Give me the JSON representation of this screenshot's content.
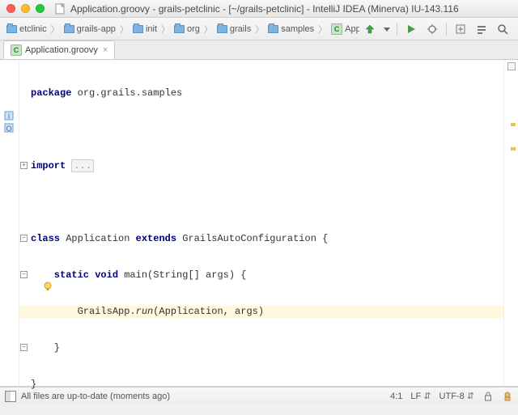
{
  "title": "Application.groovy - grails-petclinic - [~/grails-petclinic] - IntelliJ IDEA (Minerva) IU-143.116",
  "breadcrumbs": [
    {
      "label": "etclinic",
      "kind": "folder"
    },
    {
      "label": "grails-app",
      "kind": "folder"
    },
    {
      "label": "init",
      "kind": "folder"
    },
    {
      "label": "org",
      "kind": "folder"
    },
    {
      "label": "grails",
      "kind": "folder"
    },
    {
      "label": "samples",
      "kind": "folder"
    },
    {
      "label": "Application",
      "kind": "class"
    }
  ],
  "tab": {
    "label": "Application.groovy"
  },
  "code": {
    "package_kw": "package",
    "package_name": " org.grails.samples",
    "import_kw": "import",
    "import_fold": "...",
    "class_kw": "class",
    "class_name": " Application ",
    "extends_kw": "extends",
    "extends_name": " GrailsAutoConfiguration {",
    "main_mods": "    static void",
    "main_sig": " main(String[] args) {",
    "run_prefix": "        GrailsApp.",
    "run_call": "run",
    "run_args": "(Application, args)",
    "close_inner": "    }",
    "close_outer": "}"
  },
  "status": {
    "message": "All files are up-to-date (moments ago)",
    "linecol": "4:1",
    "line_sep": "LF",
    "encoding": "UTF-8"
  }
}
